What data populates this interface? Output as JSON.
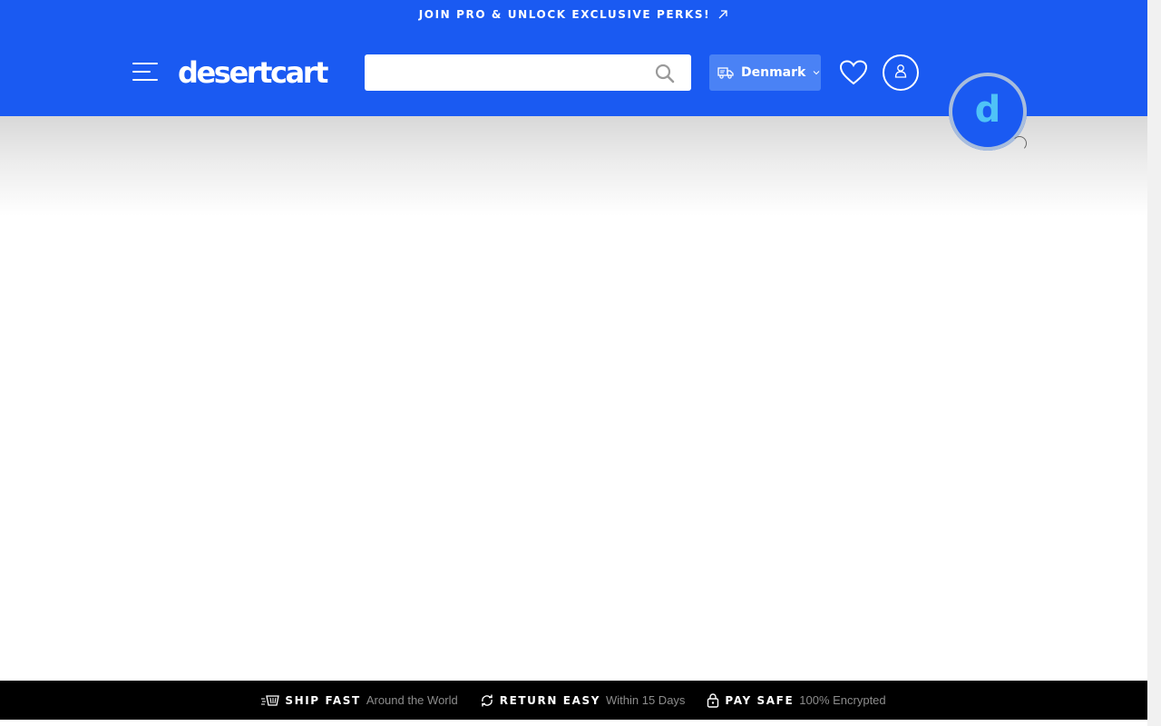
{
  "promo": {
    "text": "JOIN PRO & UNLOCK EXCLUSIVE PERKS!",
    "icon": "arrow-up-right-icon"
  },
  "header": {
    "logo": "desertcart",
    "menu_icon": "hamburger-menu-icon",
    "search": {
      "placeholder": "",
      "value": "",
      "icon": "search-icon"
    },
    "country": {
      "label": "Denmark",
      "icon": "delivery-truck-icon",
      "chevron": "chevron-down-icon"
    },
    "wishlist_icon": "heart-icon",
    "account_icon": "user-icon"
  },
  "badge": {
    "glyph": "d",
    "icon": "cart-d-icon"
  },
  "trust_bar": [
    {
      "title": "SHIP FAST",
      "subtitle": "Around the World",
      "icon": "fast-shipping-icon"
    },
    {
      "title": "RETURN EASY",
      "subtitle": "Within 15 Days",
      "icon": "refresh-icon"
    },
    {
      "title": "PAY SAFE",
      "subtitle": "100% Encrypted",
      "icon": "lock-icon"
    }
  ],
  "colors": {
    "brand_blue": "#1a5af2",
    "country_button": "#4a82f5",
    "badge_glyph": "#4fc3f7",
    "trust_bar_bg": "#000000",
    "trust_subtitle": "#8c8c8c"
  }
}
